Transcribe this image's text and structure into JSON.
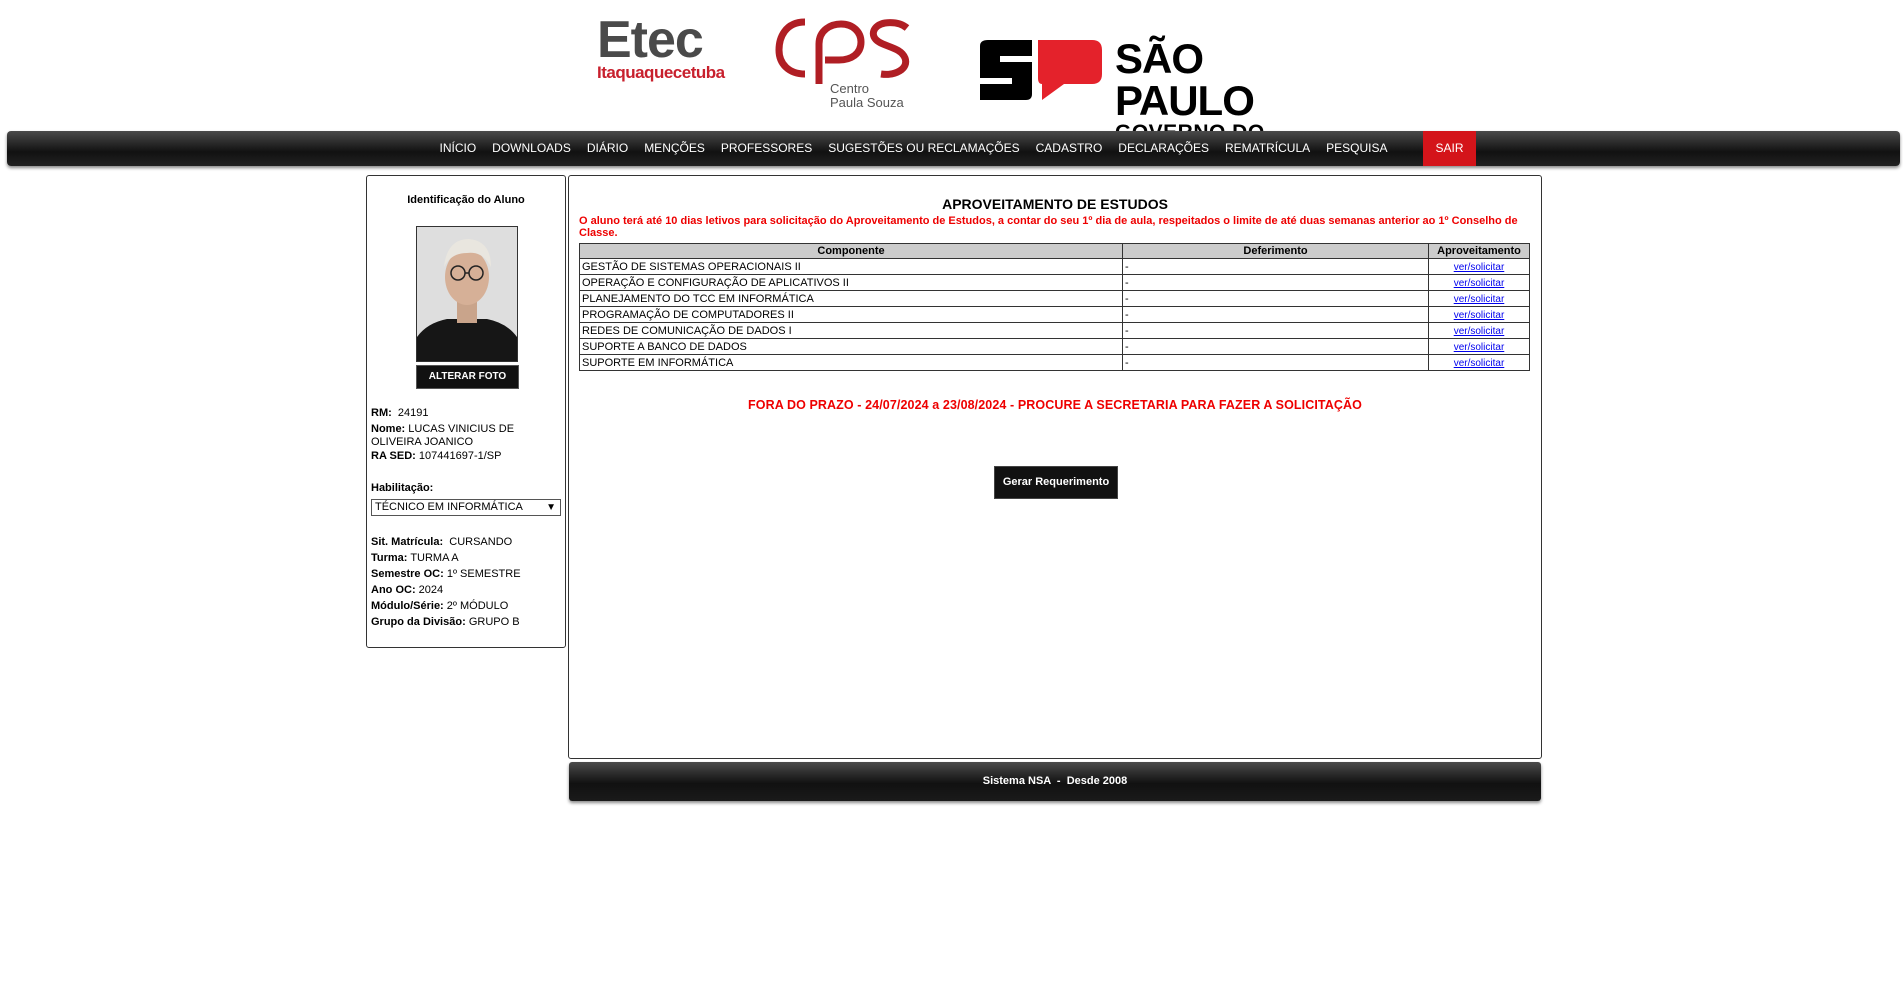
{
  "header": {
    "etec": {
      "title": "Etec",
      "subtitle": "Itaquaquecetuba"
    },
    "cps": {
      "line1": "Centro",
      "line2": "Paula Souza"
    },
    "sp": {
      "title": "SÃO PAULO",
      "subtitle": "GOVERNO DO ESTADO"
    }
  },
  "nav": {
    "items": [
      "INÍCIO",
      "DOWNLOADS",
      "DIÁRIO",
      "MENÇÕES",
      "PROFESSORES",
      "SUGESTÕES OU RECLAMAÇÕES",
      "CADASTRO",
      "DECLARAÇÕES",
      "REMATRÍCULA",
      "PESQUISA"
    ],
    "logout": "SAIR"
  },
  "student": {
    "panel_title": "Identificação do Aluno",
    "change_photo": "ALTERAR FOTO",
    "rm_label": "RM:",
    "rm": "24191",
    "name_label": "Nome:",
    "name": "LUCAS VINICIUS DE OLIVEIRA JOANICO",
    "ra_label": "RA SED:",
    "ra": "107441697-1/SP",
    "hab_label": "Habilitação:",
    "hab_value": "TÉCNICO EM INFORMÁTICA",
    "sit_label": "Sit. Matrícula:",
    "sit": "CURSANDO",
    "turma_label": "Turma:",
    "turma": "TURMA A",
    "semestre_label": "Semestre OC:",
    "semestre": "1º SEMESTRE",
    "ano_label": "Ano OC:",
    "ano": "2024",
    "modulo_label": "Módulo/Série:",
    "modulo": "2º MÓDULO",
    "grupo_label": "Grupo da Divisão:",
    "grupo": "GRUPO B"
  },
  "main": {
    "title": "APROVEITAMENTO DE ESTUDOS",
    "notice": "O aluno terá até 10 dias letivos para solicitação do Aproveitamento de Estudos, a contar do seu 1º dia de aula, respeitados o limite de até duas semanas anterior ao 1º Conselho de Classe.",
    "columns": [
      "Componente",
      "Deferimento",
      "Aproveitamento"
    ],
    "rows": [
      {
        "componente": "GESTÃO DE SISTEMAS OPERACIONAIS II",
        "deferimento": "-",
        "link": "ver/solicitar"
      },
      {
        "componente": "OPERAÇÃO E CONFIGURAÇÃO DE APLICATIVOS II",
        "deferimento": "-",
        "link": "ver/solicitar"
      },
      {
        "componente": "PLANEJAMENTO DO TCC EM INFORMÁTICA",
        "deferimento": "-",
        "link": "ver/solicitar"
      },
      {
        "componente": "PROGRAMAÇÃO DE COMPUTADORES II",
        "deferimento": "-",
        "link": "ver/solicitar"
      },
      {
        "componente": "REDES DE COMUNICAÇÃO DE DADOS I",
        "deferimento": "-",
        "link": "ver/solicitar"
      },
      {
        "componente": "SUPORTE A BANCO DE DADOS",
        "deferimento": "-",
        "link": "ver/solicitar"
      },
      {
        "componente": "SUPORTE EM INFORMÁTICA",
        "deferimento": "-",
        "link": "ver/solicitar"
      }
    ],
    "deadline": "FORA DO PRAZO - 24/07/2024 a 23/08/2024 - PROCURE A SECRETARIA PARA FAZER A SOLICITAÇÃO",
    "generate_button": "Gerar Requerimento"
  },
  "footer": {
    "text": "Sistema NSA  -  Desde 2008"
  },
  "colors": {
    "red": "#d4141a",
    "dark": "#111111",
    "link": "#0000ee"
  }
}
